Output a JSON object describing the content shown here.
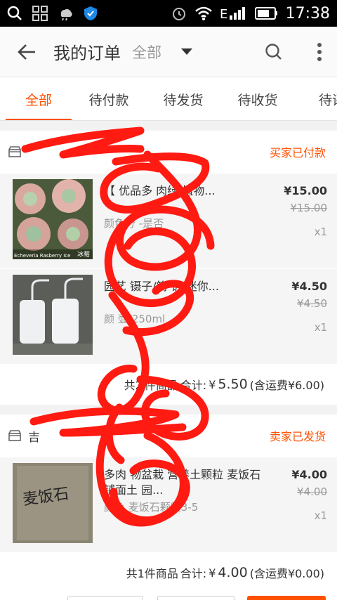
{
  "status_bar": {
    "time": "17:38"
  },
  "header": {
    "title": "我的订单",
    "filter_label": "全部"
  },
  "tabs": [
    {
      "label": "全部",
      "active": true
    },
    {
      "label": "待付款",
      "active": false
    },
    {
      "label": "待发货",
      "active": false
    },
    {
      "label": "待收货",
      "active": false
    },
    {
      "label": "待评",
      "active": false
    }
  ],
  "orders": [
    {
      "status": "买家已付款",
      "items": [
        {
          "title": "【 优品多 肉绿 植物...",
          "sku": "颜色分 -是否",
          "price": "¥15.00",
          "original_price": "¥15.00",
          "qty": "x1",
          "thumb_caption": "Echeveria Rasberry Ice",
          "thumb_caption_right": "冰莓"
        },
        {
          "title": "园艺 镊子/筒 铲 迷你...",
          "sku": "颜 壶/250ml",
          "price": "¥4.50",
          "original_price": "¥4.50",
          "qty": "x1"
        }
      ],
      "summary": {
        "count_label": "共2",
        "count_suffix": "件商品",
        "total_label": "合计:",
        "total_prefix": "¥",
        "total_value": "5.50",
        "shipping": "(含运费¥6.00)"
      }
    },
    {
      "shop_name": "吉",
      "status": "卖家已发货",
      "items": [
        {
          "title": "多肉 物盆栽 营养土颗粒 麦饭石 铺面土 园...",
          "sku": "颜色 麦饭石颗粒3-5",
          "price": "¥4.00",
          "original_price": "¥4.00",
          "qty": "x1",
          "thumb_caption": "麦饭石"
        }
      ],
      "summary": {
        "count_label": "共1件商品",
        "total_label": "合计:",
        "total_prefix": "¥",
        "total_value": "4.00",
        "shipping": "(含运费¥0.00)"
      }
    }
  ],
  "colors": {
    "accent": "#ff5000",
    "scribble": "#ff1a12"
  }
}
